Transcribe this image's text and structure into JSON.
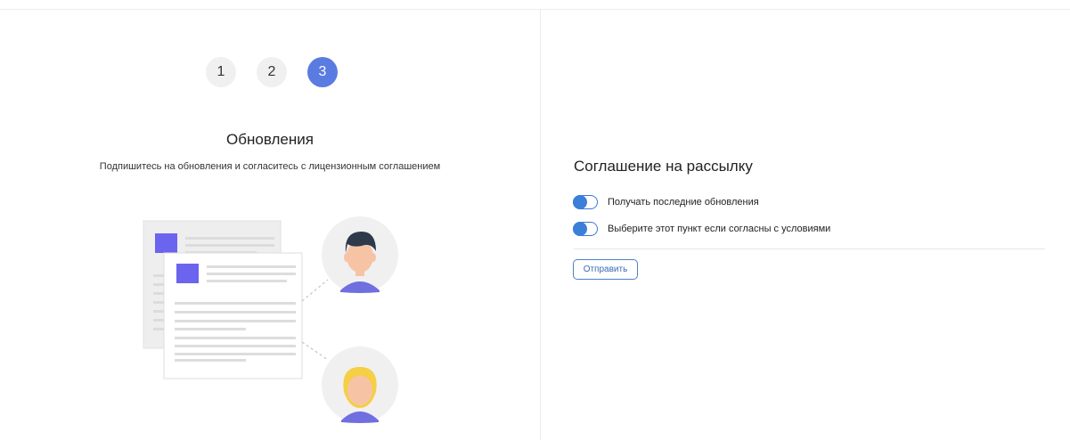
{
  "steps": [
    "1",
    "2",
    "3"
  ],
  "active_step": "3",
  "left": {
    "title": "Обновления",
    "subtitle": "Подпишитесь на обновления и согласитесь с лицензионным соглашением"
  },
  "form": {
    "title": "Соглашение на рассылку",
    "toggles": [
      {
        "label": "Получать последние обновления",
        "checked": true
      },
      {
        "label": "Выберите этот пункт если согласны с условиями",
        "checked": true
      }
    ],
    "submit_label": "Отправить"
  },
  "colors": {
    "accent": "#5a7be0",
    "toggle": "#3b7fd9",
    "doc_square": "#6b64ee",
    "avatar_bg": "#f0f0f0",
    "shirt": "#6f6fe0",
    "male_hair": "#2e3a4a",
    "female_hair": "#f5cf45",
    "skin": "#f7c3a5"
  }
}
